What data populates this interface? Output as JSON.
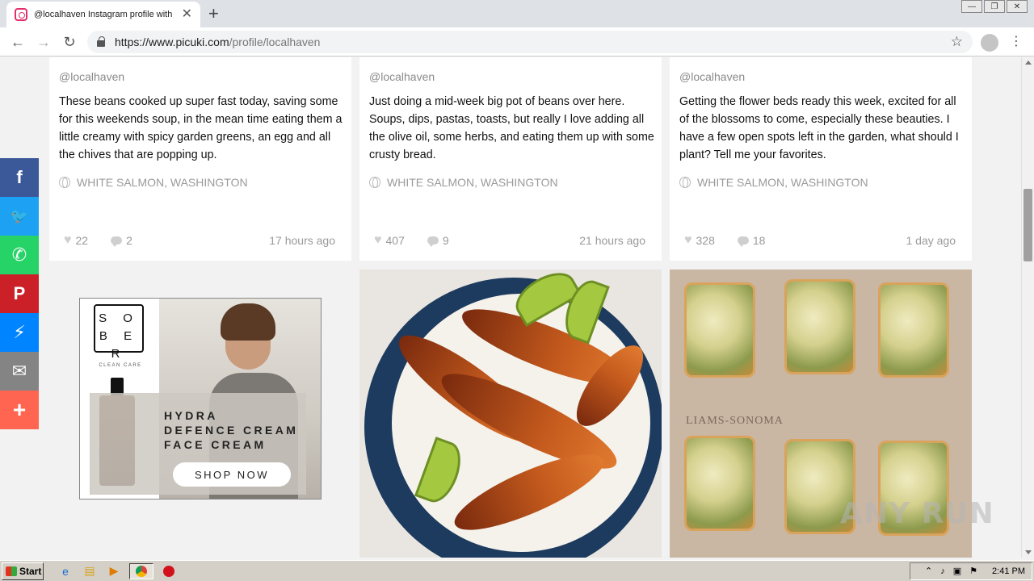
{
  "browser": {
    "tab_title": "@localhaven Instagram profile with p",
    "tab_close": "✕",
    "new_tab": "+",
    "url_host": "https://www.picuki.com",
    "url_path": "/profile/localhaven",
    "star": "☆",
    "back": "←",
    "forward": "→",
    "reload": "↻",
    "menu": "⋮",
    "win_min": "—",
    "win_max": "❐",
    "win_close": "✕"
  },
  "posts": [
    {
      "user": "@localhaven",
      "caption": "These beans cooked up super fast today, saving some for this weekends soup, in the mean time eating them a little creamy with spicy garden greens, an egg and all the chives that are popping up.",
      "location": "WHITE SALMON, WASHINGTON",
      "likes": "22",
      "comments": "2",
      "time": "17 hours ago"
    },
    {
      "user": "@localhaven",
      "caption": "Just doing a mid-week big pot of beans over here. Soups, dips, pastas, toasts, but really I love adding all the olive oil, some herbs, and eating them up with some crusty bread.",
      "location": "WHITE SALMON, WASHINGTON",
      "likes": "407",
      "comments": "9",
      "time": "21 hours ago"
    },
    {
      "user": "@localhaven",
      "caption": "Getting the flower beds ready this week, excited for all of the blossoms to come, especially these beauties. I have a few open spots left in the garden, what should I plant? Tell me your favorites.",
      "location": "WHITE SALMON, WASHINGTON",
      "likes": "328",
      "comments": "18",
      "time": "1 day ago"
    }
  ],
  "ad": {
    "logo": "SOBER",
    "tagline": "CLEAN CARE",
    "headline_1": "HYDRA",
    "headline_2": "DEFENCE CREAM",
    "headline_3": "FACE CREAM",
    "cta": "SHOP NOW"
  },
  "food_watermark": "LIAMS-SONOMA",
  "watermark": "ANY RUN",
  "social": [
    {
      "icon": "facebook-icon",
      "glyph": "f",
      "color": "#3b5998"
    },
    {
      "icon": "twitter-icon",
      "glyph": "🐦",
      "color": "#1da1f2"
    },
    {
      "icon": "whatsapp-icon",
      "glyph": "✆",
      "color": "#25d366"
    },
    {
      "icon": "pinterest-icon",
      "glyph": "P",
      "color": "#cb2027"
    },
    {
      "icon": "messenger-icon",
      "glyph": "⚡",
      "color": "#0084ff"
    },
    {
      "icon": "email-icon",
      "glyph": "✉",
      "color": "#848484"
    },
    {
      "icon": "more-icon",
      "glyph": "+",
      "color": "#ff6550"
    }
  ],
  "taskbar": {
    "start": "Start",
    "time": "2:41 PM"
  }
}
